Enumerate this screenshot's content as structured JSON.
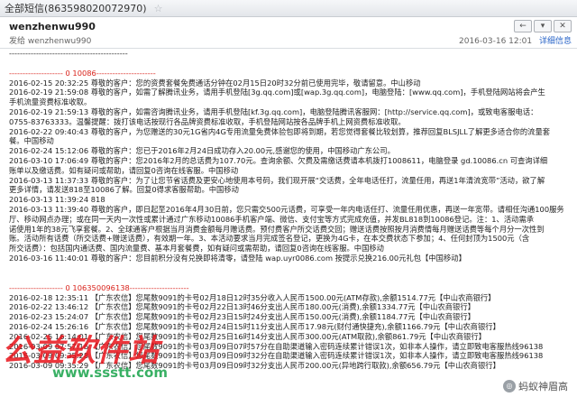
{
  "window": {
    "title": "全部短信(86359802007297​0)"
  },
  "header": {
    "sender": "wenzhenwu990",
    "to": "发给 wenzhenwu990",
    "datetime": "2016-03-16 12:01",
    "details_link": "详细信息"
  },
  "toolbar": {
    "reply_icon": "←",
    "dropdown_icon": "▾",
    "close_icon": "✕"
  },
  "separator": "--------------------------------------------",
  "section1": {
    "header": "-------------------- 0 10086----------------------",
    "lines": [
      "2016-02-15 20:32:25 尊敬的客户：您的资费套餐免费通话分钟在02月15日20时32分前已使用完毕，敬请留意。中山移动",
      "2016-02-19 21:59:08 尊敬的客户，如需了解腾讯业务，请用手机登陆[3g.qq.com]或[wap.3g.qq.com]，电脑登陆：[www.qq.com]，手机登陆网站将会产生",
      "手机流量资费标准收取。",
      "2016-02-19 21:59:13 尊敬的客户，如需咨询腾讯业务，请用手机登陆[kf.3g.qq.com]，电脑登陆腾讯客服网：[http://service.qq.com]，或致电客服电话：",
      "0755-83763333。温馨提醒：拨打该电话按现行各品牌资费标准收取，手机登陆网站按各品牌手机上网资费标准收取。",
      "2016-02-22 09:40:43 尊敬的客户，为您赠送的30元1G省内4G专用流量免费体验包即将到期，若您觉得套餐比较划算，推荐回复BLSJLL了解更多适合你的流量套",
      "餐。中国移动",
      "2016-02-24 15:12:06 尊敬的客户：您已于2016年2月24日成功存入20.00元,感谢您的使用，中国移动广东公司。",
      "2016-03-10 17:06:49 尊敬的客户：您2016年2月的总话费为107.70元。查询余额、欠费及需缴话费请本机拨打1008611，电脑登录 gd.10086.cn 可查询详细",
      "账单以及缴话费。如有疑问或帮助，请回复0咨询在线客服。中国移动",
      "2016-03-13 11:37:33 尊敬的客户：为了让您节省话费及更安心地使用本号码，我们现开展“交话费，全年电话任打，流量任用，再送1年清流宽带”活动，欲了解",
      "更多详情，请发送818至10086了解。回复0得求客服帮助。中国移动",
      "2016-03-13 11:39:24 818",
      "2016-03-13 11:39:40 尊敬的客户，即日起至2016年4月30日前，您只需交500元话费，可享受一年内电话任打、流量任用优惠，再送一年宽带。请相任沟通100服务",
      "厅、移动网点办理；或在同一天内一次性或累计通过广东移动10086手机客户端、微信、支付宝等方式完成充值，并发BL818到10086登记。注：1、活动需承",
      "诺使用1年的38元飞享套餐。2、全球通客户根据当月消费金额每月赠话费。预付费客户所交话费交回；赠送话费按照按月消费情每月赠送话费等每个月分一次性到",
      "账。活动所有话费（所交话费+赠送话费），有效期一年。3、本活动要求当月完成签名登记，更换为4G卡，在本交费状态下参加；4、任何封顶为1500元（含",
      "所交话费）：包括国内通话费、国内流量费、基本月套餐费，如有疑问或需帮助，请回复0咨询在线客服。中国移动",
      "2016-03-16 11:40:01 尊敬的客户：您目前积分没有兑换即将清零，请登陆 wap.uyr0086.com 按提示兑换216.00元礼包【中国移动】"
    ]
  },
  "section2": {
    "header": "-------------------- 0 106350096138----------------------",
    "lines": [
      "2016-02-18 12:35:11 【广东农信】您尾数9091的卡号02月18日12时35分收入人民币1500.00元(ATM存款),余额1514.77元【中山农商银行】",
      "2016-02-22 13:46:12 【广东农信】您尾数9091的卡号02月22日13时46分支出人民币180.00元(消费),余额1334.77元【中山农商银行】",
      "2016-02-23 15:24:07 【广东农信】您尾数9091的卡号02月23日15时24分支出人民币150.00元(消费),余额1184.77元【中山农商银行】",
      "2016-02-24 15:26:16 【广东农信】您尾数9091的卡号02月24日15时11分支出人民币17.98元(财付通快捷充),余额1166.79元【中山农商银行】",
      "2016-02-25 16:14:01 【广东农信】您尾数9091的卡号02月25日16时14分支出人民币300.00元(ATM取款),余额861.79元【中山农商银行】",
      "2016-03-09 07:57:16 【广东农信】您尾数9091的卡号03月09日07时57分在自助渠道输入密码连续累计错误1次，如非本人操作，请立即致电客服热线96138",
      "2016-03-09 09:35:28 【广东农信】您尾数9091的卡号03月09日09时32分在自助渠道输入密码连续累计错误1次，如非本人操作，请立即致电客服热线96138",
      "2016-03-09 09:35:29 【广东农信】您尾数9091的卡号03月09日09时32分支出人民币200.00元(异地跨行取款),余额656.79元【中山农商银行】"
    ]
  },
  "watermarks": {
    "site_logo": "公益软件站",
    "site_url": "www.ssstt.com",
    "account": "蚂蚁神眉高"
  }
}
